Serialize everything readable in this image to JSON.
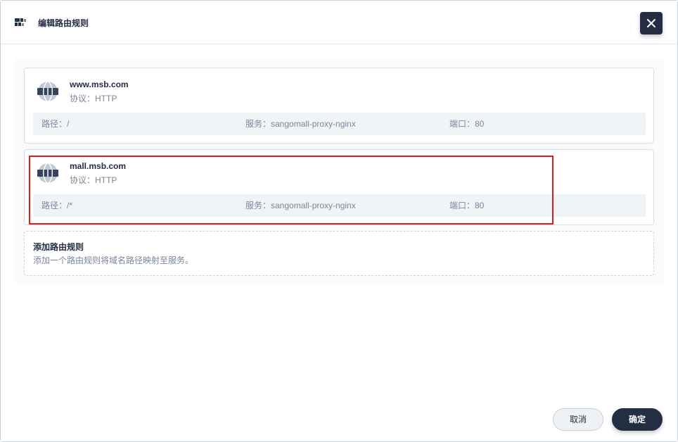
{
  "dialog": {
    "title": "编辑路由规则",
    "header_icon": "router-rules-icon",
    "close_icon": "close-icon"
  },
  "rules": [
    {
      "host": "www.msb.com",
      "protocol": "协议：HTTP",
      "path": "路径：/",
      "service": "服务：sangomall-proxy-nginx",
      "port": "端口：80",
      "icon": "globe-icon"
    },
    {
      "host": "mall.msb.com",
      "protocol": "协议：HTTP",
      "path": "路径：/*",
      "service": "服务：sangomall-proxy-nginx",
      "port": "端口：80",
      "icon": "globe-icon",
      "highlighted": true
    }
  ],
  "add_rule": {
    "title": "添加路由规则",
    "description": "添加一个路由规则将域名路径映射至服务。"
  },
  "footer": {
    "cancel_label": "取消",
    "confirm_label": "确定"
  },
  "colors": {
    "primary": "#242e42",
    "muted_text": "#79879c",
    "highlight": "#e01b1b",
    "meta_bg": "#f1f4f7"
  }
}
